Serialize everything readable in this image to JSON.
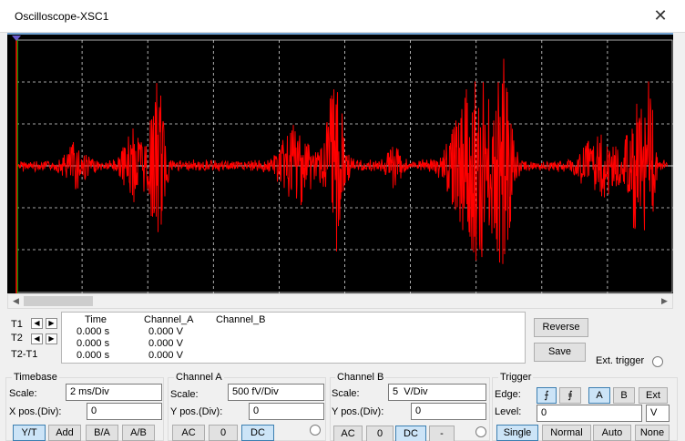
{
  "window": {
    "title": "Oscilloscope-XSC1",
    "close": "✕"
  },
  "colors": {
    "trace": "#ff0000",
    "grid": "#d8d8d8",
    "screen": "#000000",
    "cursor1": "#ff0000",
    "cursor2": "#00c000"
  },
  "scrollbar": {
    "left_arrow": "◀",
    "right_arrow": "▶"
  },
  "cursors": {
    "rows": [
      {
        "label": "T1",
        "left": "◀",
        "right": "▶"
      },
      {
        "label": "T2",
        "left": "◀",
        "right": "▶"
      },
      {
        "label": "T2-T1"
      }
    ]
  },
  "readout": {
    "headers": {
      "time": "Time",
      "channel_a": "Channel_A",
      "channel_b": "Channel_B"
    },
    "rows": [
      {
        "time": "0.000 s",
        "channel_a": "0.000 V"
      },
      {
        "time": "0.000 s",
        "channel_a": "0.000 V"
      },
      {
        "time": "0.000 s",
        "channel_a": "0.000 V"
      }
    ]
  },
  "actions": {
    "reverse": "Reverse",
    "save": "Save",
    "ext_trigger": "Ext. trigger"
  },
  "timebase": {
    "title": "Timebase",
    "scale_label": "Scale:",
    "scale_value": "2 ms/Div",
    "xpos_label": "X pos.(Div):",
    "xpos_value": "0",
    "modes": [
      "Y/T",
      "Add",
      "B/A",
      "A/B"
    ],
    "active_mode": "Y/T"
  },
  "channel_a": {
    "title": "Channel A",
    "scale_label": "Scale:",
    "scale_value": "500 fV/Div",
    "ypos_label": "Y pos.(Div):",
    "ypos_value": "0",
    "coupling": [
      "AC",
      "0",
      "DC"
    ],
    "active_coupling": "DC"
  },
  "channel_b": {
    "title": "Channel B",
    "scale_label": "Scale:",
    "scale_value": "5  V/Div",
    "ypos_label": "Y pos.(Div):",
    "ypos_value": "0",
    "coupling": [
      "AC",
      "0",
      "DC",
      "-"
    ],
    "active_coupling": "DC"
  },
  "trigger": {
    "title": "Trigger",
    "edge_label": "Edge:",
    "edge_rising": "⨍",
    "edge_falling": "⨎",
    "sources": [
      "A",
      "B",
      "Ext"
    ],
    "active_source": "A",
    "level_label": "Level:",
    "level_value": "0",
    "level_unit": "V",
    "modes": [
      "Single",
      "Normal",
      "Auto",
      "None"
    ],
    "active_mode": "Single"
  }
}
